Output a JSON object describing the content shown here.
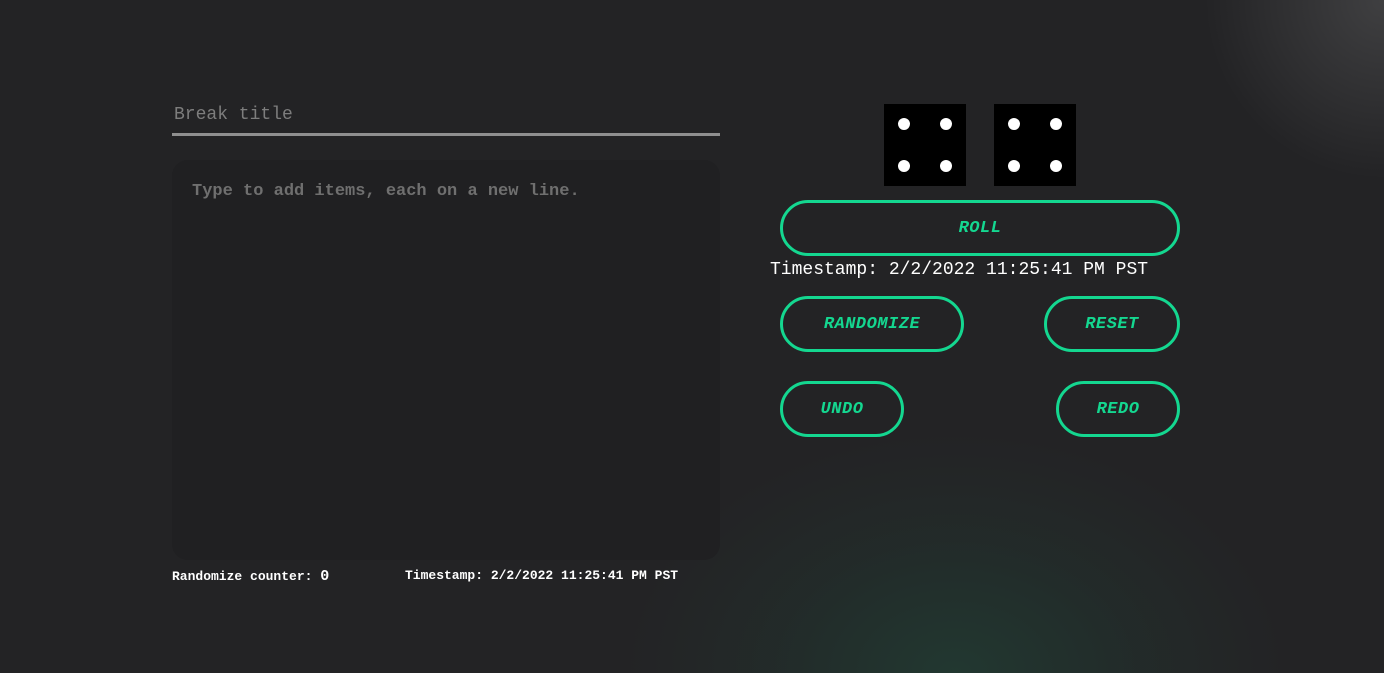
{
  "editor": {
    "title_placeholder": "Break title",
    "title_value": "",
    "items_placeholder": "Type to add items, each on a new line.",
    "items_value": ""
  },
  "stats": {
    "counter_label": "Randomize counter: ",
    "counter_value": "0",
    "timestamp_label": "Timestamp: ",
    "timestamp_value": "2/2/2022 11:25:41 PM PST"
  },
  "dice": {
    "values": [
      4,
      4
    ]
  },
  "controls": {
    "roll_label": "ROLL",
    "roll_timestamp": "Timestamp: 2/2/2022 11:25:41 PM PST",
    "randomize_label": "RANDOMIZE",
    "reset_label": "RESET",
    "undo_label": "UNDO",
    "redo_label": "REDO"
  },
  "colors": {
    "background": "#232325",
    "accent": "#14d790",
    "panel": "#202022",
    "die": "#000000",
    "pip": "#ffffff"
  }
}
